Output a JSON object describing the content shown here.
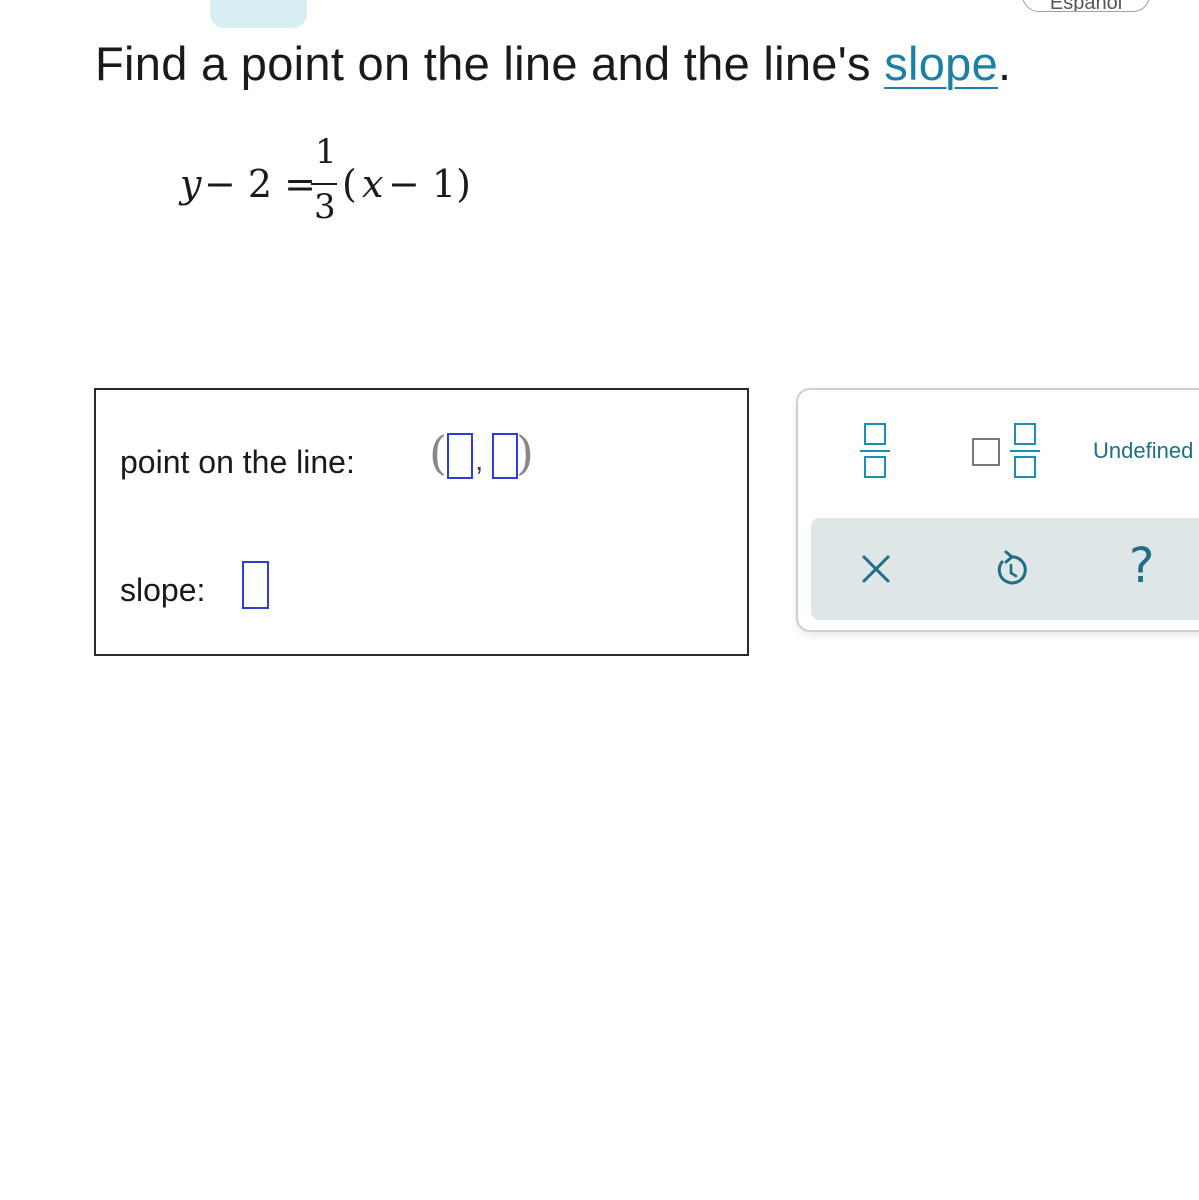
{
  "header": {
    "language_button": "Español"
  },
  "question": {
    "text_before": "Find a point on the line and the line's ",
    "link": "slope",
    "text_after": "."
  },
  "equation": {
    "lhs_var": "y",
    "lhs_rest": "− 2 =",
    "fraction_numerator": "1",
    "fraction_denominator": "3",
    "rhs_open": "(",
    "rhs_var": "x",
    "rhs_rest": "− 1)"
  },
  "answer": {
    "point_label": "point on the line:",
    "point_x_value": "",
    "point_y_value": "",
    "slope_label": "slope:",
    "slope_value": ""
  },
  "keypad": {
    "icons": [
      "fraction-icon",
      "mixed-number-icon",
      "clear-icon",
      "undo-icon",
      "help-icon"
    ],
    "undefined_label": "Undefined",
    "help_label": "?"
  },
  "colors": {
    "link": "#1c7fa6",
    "accent": "#1b8fb2",
    "blank_border": "#2b3fd6",
    "keypad_row_bg": "#dfe6e8"
  }
}
